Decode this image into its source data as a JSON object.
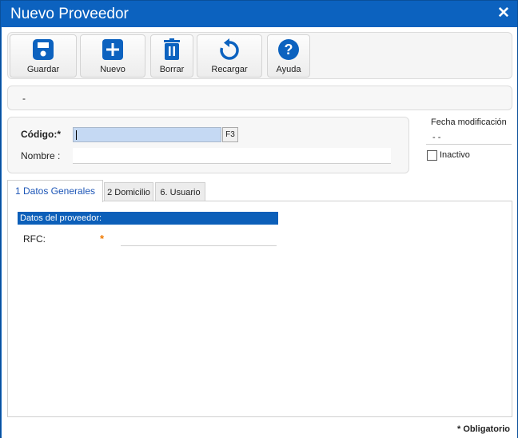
{
  "window": {
    "title": "Nuevo Proveedor",
    "close_glyph": "✕"
  },
  "toolbar": {
    "buttons": [
      {
        "label": "Guardar",
        "icon": "save-icon"
      },
      {
        "label": "Nuevo",
        "icon": "plus-icon"
      },
      {
        "label": "Borrar",
        "icon": "trash-icon"
      },
      {
        "label": "Recargar",
        "icon": "reload-icon"
      },
      {
        "label": "Ayuda",
        "icon": "help-icon"
      }
    ]
  },
  "info": {
    "text": "-"
  },
  "form": {
    "codigo_label": "Código:*",
    "codigo_value": "",
    "f3_label": "F3",
    "nombre_label": "Nombre :",
    "nombre_value": "",
    "fecha_label": "Fecha modificación",
    "fecha_value": "- -",
    "inactivo_label": "Inactivo",
    "inactivo_checked": false
  },
  "tabs": [
    {
      "label": "1 Datos Generales",
      "active": true
    },
    {
      "label": "2 Domicilio",
      "active": false
    },
    {
      "label": "6. Usuario",
      "active": false
    }
  ],
  "datos": {
    "section_title": "Datos del proveedor:",
    "rfc_label": "RFC:",
    "rfc_required": "*",
    "rfc_value": ""
  },
  "footer": {
    "obligatorio": "* Obligatorio"
  },
  "colors": {
    "accent": "#0c62bf",
    "required": "#f07a00",
    "selected_input": "#c5d9f3"
  }
}
